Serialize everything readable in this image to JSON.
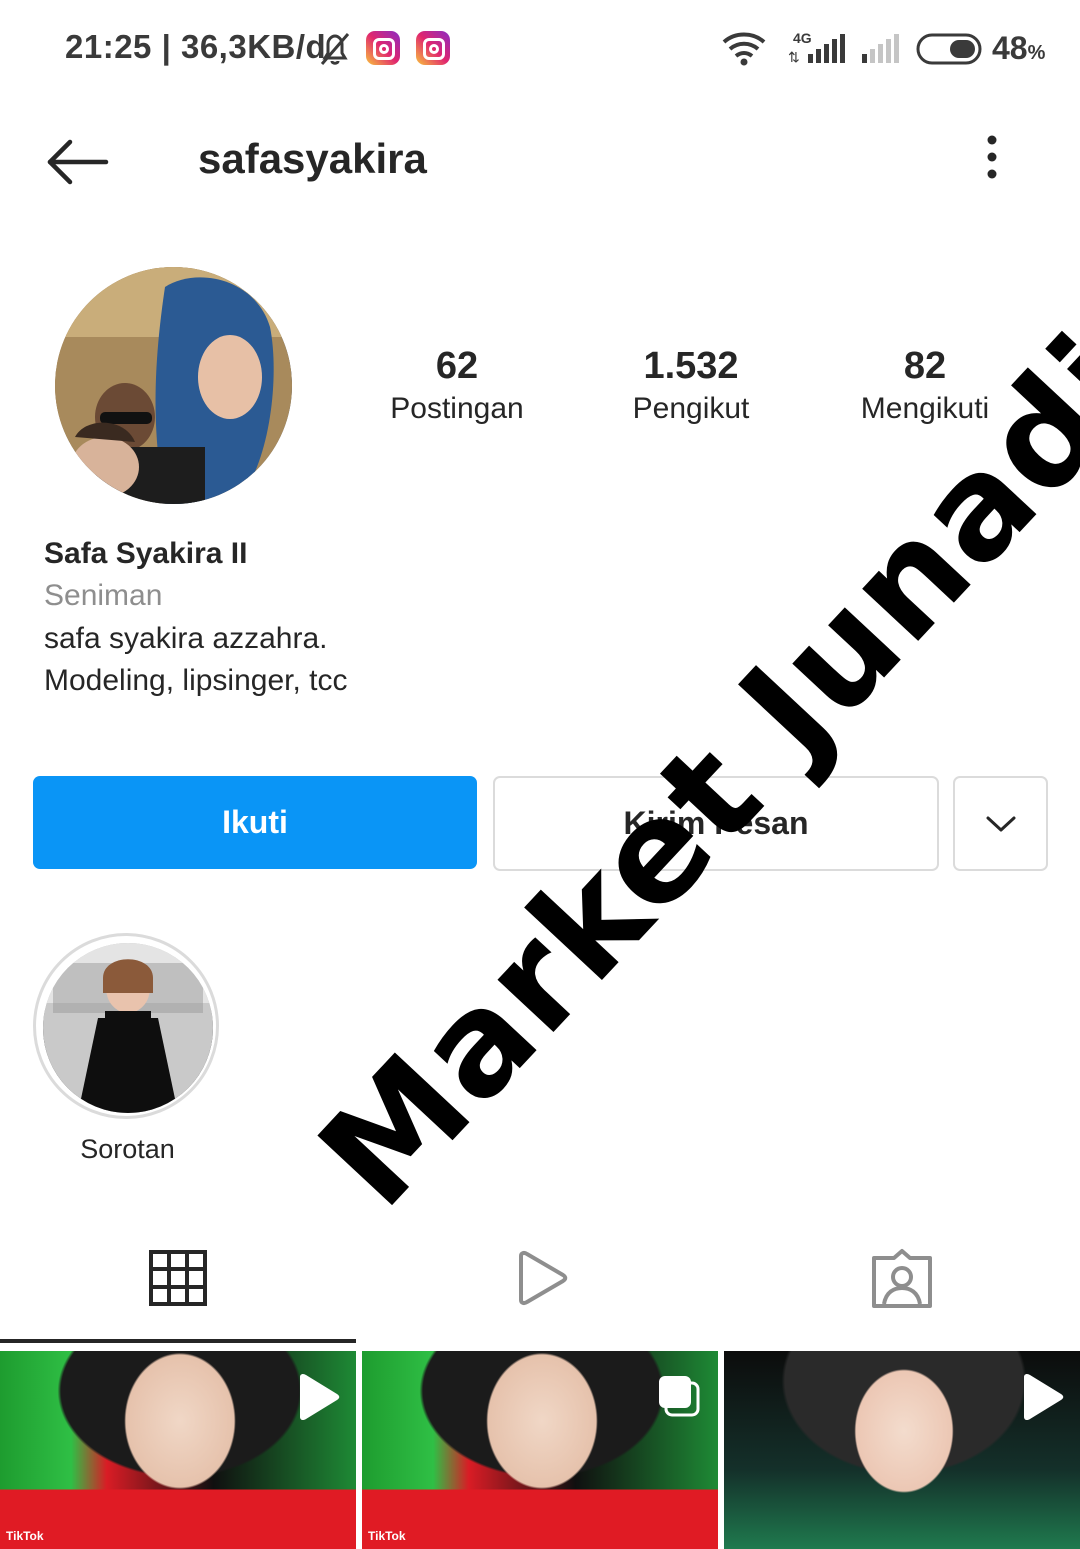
{
  "status_bar": {
    "time_info": "21:25 | 36,3KB/d",
    "network_type": "4G",
    "battery": "48",
    "battery_unit": "%"
  },
  "header": {
    "username": "safasyakira"
  },
  "stats": [
    {
      "value": "62",
      "label": "Postingan"
    },
    {
      "value": "1.532",
      "label": "Pengikut"
    },
    {
      "value": "82",
      "label": "Mengikuti"
    }
  ],
  "bio": {
    "full_name": "Safa Syakira II",
    "category": "Seniman",
    "lines": [
      "safa syakira azzahra.",
      "Modeling, lipsinger, tcc"
    ]
  },
  "actions": {
    "follow": "Ikuti",
    "message": "Kirim Pesan"
  },
  "highlights": [
    {
      "label": "Sorotan"
    }
  ],
  "posts": [
    {
      "watermark": "TikTok",
      "type_icon": "play-icon"
    },
    {
      "watermark": "TikTok",
      "type_icon": "multiple-icon"
    },
    {
      "watermark": "",
      "type_icon": "play-icon"
    }
  ],
  "overlay": {
    "watermark_text": "Market Junadi"
  },
  "colors": {
    "follow_button": "#0a95f6",
    "text_primary": "#262626",
    "text_secondary": "#8e8e8e",
    "border": "#dbdbdb"
  }
}
